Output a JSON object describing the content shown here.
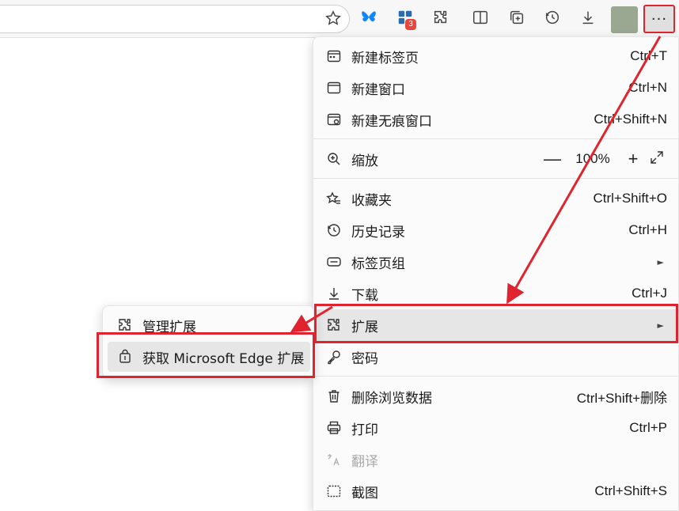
{
  "toolbar": {
    "icons": [
      "star-icon",
      "bluesky-extension-icon",
      "extensions-badge-icon",
      "extensions-icon",
      "split-screen-icon",
      "collections-icon",
      "history-icon",
      "downloads-icon"
    ],
    "badge_count": "3",
    "more_label": "···"
  },
  "menu": {
    "items": [
      {
        "label": "新建标签页",
        "shortcut": "Ctrl+T",
        "icon": "new-tab-icon"
      },
      {
        "label": "新建窗口",
        "shortcut": "Ctrl+N",
        "icon": "new-window-icon"
      },
      {
        "label": "新建无痕窗口",
        "shortcut": "Ctrl+Shift+N",
        "icon": "inprivate-icon"
      },
      {
        "label": "缩放",
        "icon": "zoom-icon",
        "zoom_value": "100%",
        "zoom_minus": "—",
        "zoom_plus": "+"
      },
      {
        "label": "收藏夹",
        "shortcut": "Ctrl+Shift+O",
        "icon": "favorites-icon"
      },
      {
        "label": "历史记录",
        "shortcut": "Ctrl+H",
        "icon": "history-icon"
      },
      {
        "label": "标签页组",
        "icon": "tab-groups-icon"
      },
      {
        "label": "下载",
        "shortcut": "Ctrl+J",
        "icon": "download-icon"
      },
      {
        "label": "扩展",
        "icon": "extensions-icon"
      },
      {
        "label": "密码",
        "icon": "password-key-icon"
      },
      {
        "label": "删除浏览数据",
        "shortcut": "Ctrl+Shift+删除",
        "icon": "trash-icon"
      },
      {
        "label": "打印",
        "shortcut": "Ctrl+P",
        "icon": "print-icon"
      },
      {
        "label": "翻译",
        "icon": "translate-icon"
      },
      {
        "label": "截图",
        "shortcut": "Ctrl+Shift+S",
        "icon": "screenshot-icon"
      }
    ],
    "submenu_arrow": "►"
  },
  "submenu": {
    "items": [
      {
        "label": "管理扩展",
        "icon": "extensions-icon"
      },
      {
        "label": "获取 Microsoft Edge 扩展",
        "icon": "store-bag-icon"
      }
    ]
  },
  "colors": {
    "annotation_red": "#e0242f",
    "hover_gray": "#e6e6e6",
    "badge_red": "#e8453c"
  }
}
